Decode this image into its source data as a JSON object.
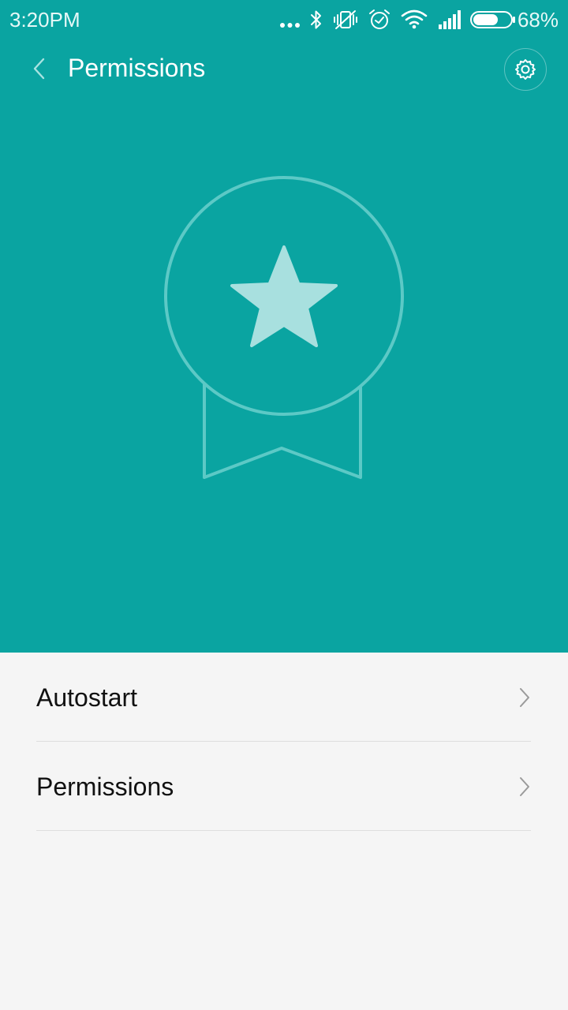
{
  "status_bar": {
    "time": "3:20PM",
    "battery_percent": "68%",
    "battery_level": 0.68,
    "icons": [
      "more-dots-icon",
      "bluetooth-icon",
      "vibrate-off-icon",
      "alarm-icon",
      "wifi-icon",
      "signal-icon",
      "battery-icon"
    ]
  },
  "toolbar": {
    "title": "Permissions",
    "back_icon": "chevron-left-icon",
    "settings_icon": "gear-icon"
  },
  "hero": {
    "icon": "award-badge-star-icon"
  },
  "list": {
    "items": [
      {
        "label": "Autostart",
        "icon": "chevron-right-icon"
      },
      {
        "label": "Permissions",
        "icon": "chevron-right-icon"
      }
    ]
  },
  "colors": {
    "header_bg": "#0aa4a1",
    "page_bg": "#f5f5f5",
    "badge_stroke": "#5cc9c6",
    "star_fill": "#a8e0df",
    "divider": "#dedede"
  }
}
